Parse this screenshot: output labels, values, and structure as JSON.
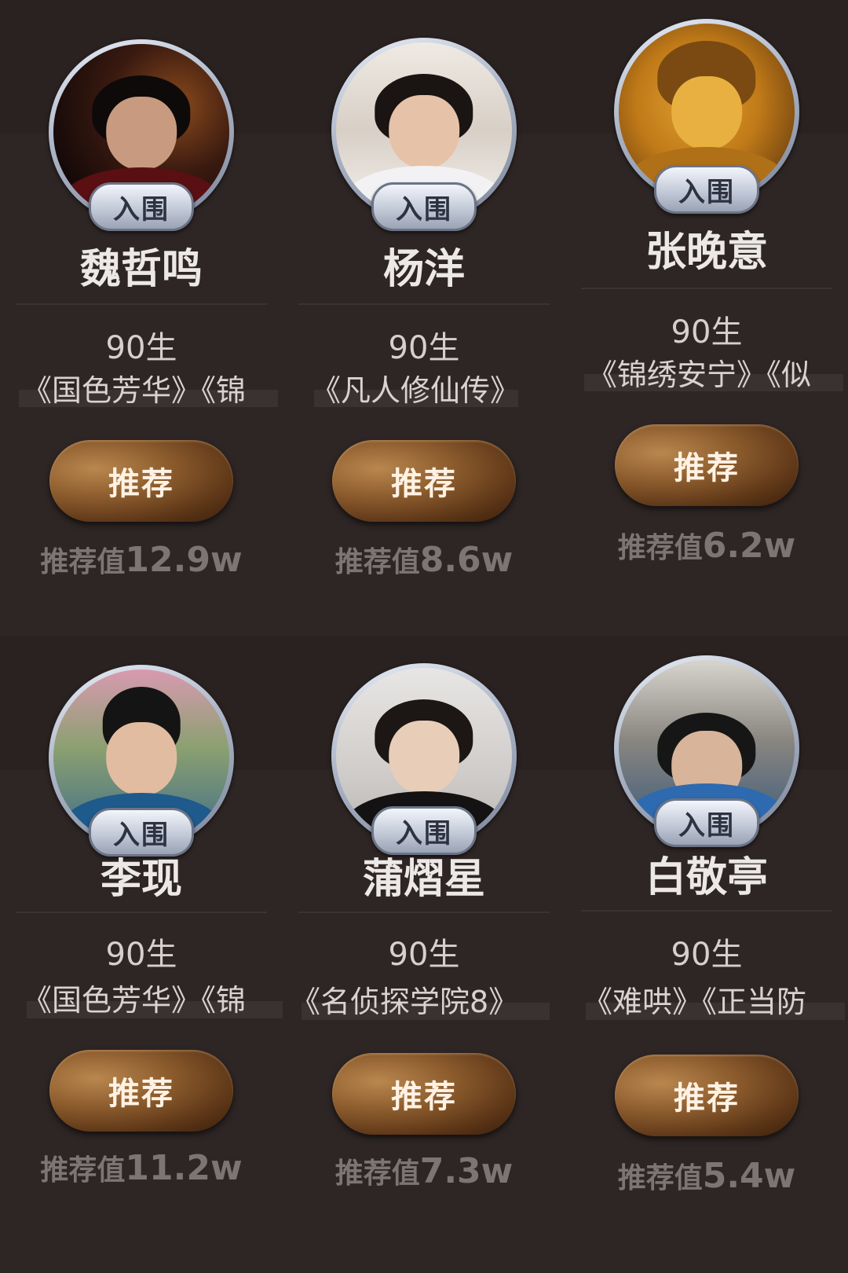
{
  "cards": [
    {
      "badge": "入围",
      "name": "魏哲鸣",
      "age": "90生",
      "works": "《国色芳华》《锦",
      "button": "推荐",
      "score_label": "推荐值",
      "score_value": "12.9w"
    },
    {
      "badge": "入围",
      "name": "杨洋",
      "age": "90生",
      "works": "《凡人修仙传》",
      "button": "推荐",
      "score_label": "推荐值",
      "score_value": "8.6w"
    },
    {
      "badge": "入围",
      "name": "张晚意",
      "age": "90生",
      "works": "《锦绣安宁》《似",
      "button": "推荐",
      "score_label": "推荐值",
      "score_value": "6.2w"
    },
    {
      "badge": "入围",
      "name": "李现",
      "age": "90生",
      "works": "《国色芳华》《锦",
      "button": "推荐",
      "score_label": "推荐值",
      "score_value": "11.2w"
    },
    {
      "badge": "入围",
      "name": "蒲熠星",
      "age": "90生",
      "works": "《名侦探学院8》",
      "button": "推荐",
      "score_label": "推荐值",
      "score_value": "7.3w"
    },
    {
      "badge": "入围",
      "name": "白敬亭",
      "age": "90生",
      "works": "《难哄》《正当防",
      "button": "推荐",
      "score_label": "推荐值",
      "score_value": "5.4w"
    }
  ],
  "colors": {
    "card_bg": "#2e2625",
    "button_bronze": "#8a5a2c",
    "badge_silver": "#c3cad8"
  }
}
